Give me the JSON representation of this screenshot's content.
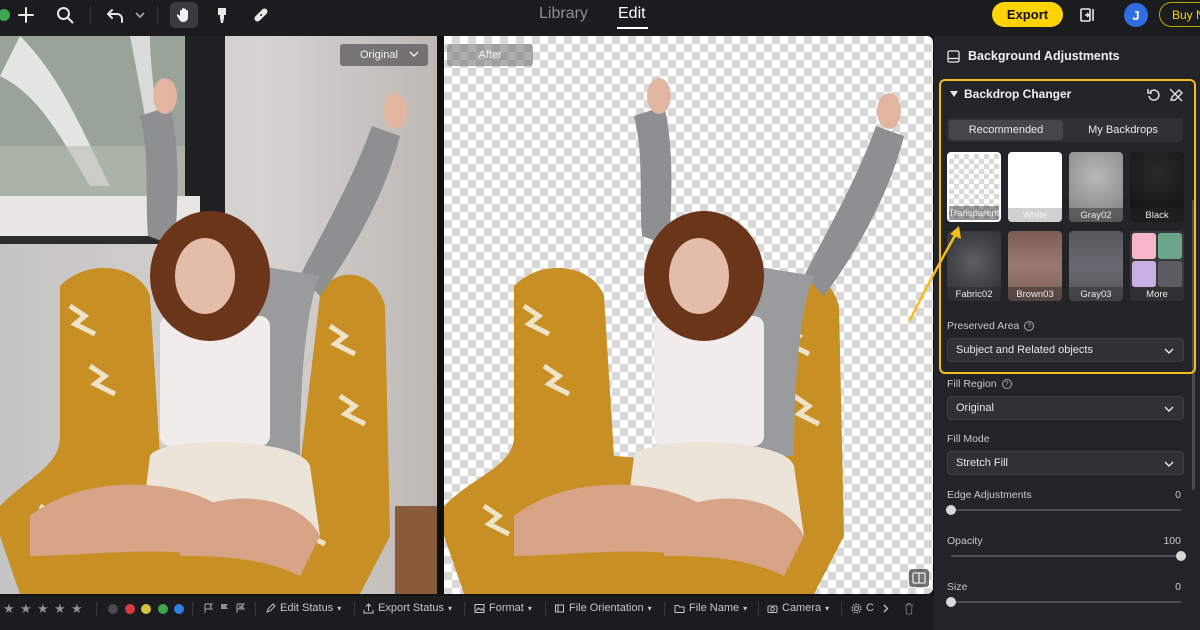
{
  "topbar": {
    "tabs": [
      {
        "label": "Library",
        "active": false
      },
      {
        "label": "Edit",
        "active": true
      }
    ],
    "export_label": "Export",
    "avatar_initial": "J",
    "buy_label": "Buy Now",
    "tools": [
      "add-icon",
      "search-icon",
      "undo-icon",
      "hand-icon",
      "brush-icon",
      "bandage-icon"
    ]
  },
  "canvas": {
    "before_dropdown": "Original",
    "after_label": "After"
  },
  "bottombar": {
    "stars": [
      "★",
      "★",
      "★",
      "★",
      "★"
    ],
    "color_labels": [
      "#4a4b4f",
      "#d83b3b",
      "#d8c040",
      "#3fa650",
      "#2f7fe0"
    ],
    "items": [
      "Edit Status",
      "Export Status",
      "Format",
      "File Orientation",
      "File Name",
      "Camera",
      "C"
    ]
  },
  "panel": {
    "header": "Background Adjustments",
    "section_title": "Backdrop Changer",
    "segments": [
      {
        "label": "Recommended",
        "active": true
      },
      {
        "label": "My Backdrops",
        "active": false
      }
    ],
    "backdrops": [
      {
        "label": "Transparent",
        "selected": true
      },
      {
        "label": "White",
        "selected": false
      },
      {
        "label": "Gray02",
        "selected": false
      },
      {
        "label": "Black",
        "selected": false
      },
      {
        "label": "Fabric02",
        "selected": false
      },
      {
        "label": "Brown03",
        "selected": false
      },
      {
        "label": "Gray03",
        "selected": false
      },
      {
        "label": "More",
        "selected": false
      }
    ],
    "preserved_area": {
      "label": "Preserved Area",
      "value": "Subject and Related objects"
    },
    "fill_region": {
      "label": "Fill Region",
      "value": "Original"
    },
    "fill_mode": {
      "label": "Fill Mode",
      "value": "Stretch Fill"
    },
    "edge_adjustments": {
      "label": "Edge Adjustments",
      "value": "0",
      "fraction": 0
    },
    "opacity": {
      "label": "Opacity",
      "value": "100",
      "fraction": 1
    },
    "size": {
      "label": "Size",
      "value": "0",
      "fraction": 0
    },
    "highlight_color": "#f4bc1c",
    "accent_color": "#ffd400"
  }
}
